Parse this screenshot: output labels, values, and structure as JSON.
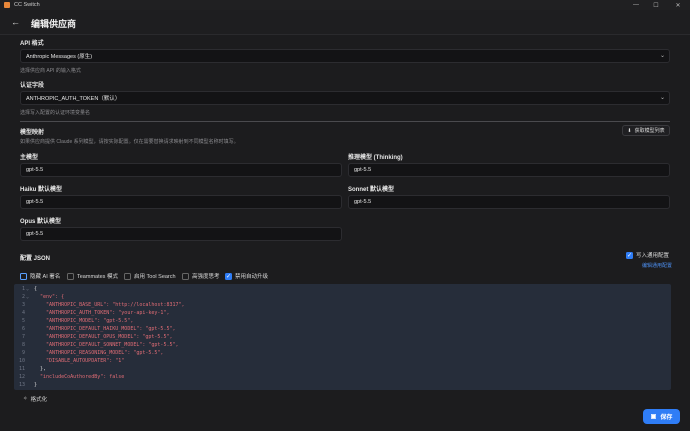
{
  "window": {
    "app_title": "CC Switch",
    "minimize": "—",
    "maximize": "☐",
    "close": "✕"
  },
  "header": {
    "back": "←",
    "title": "编辑供应商"
  },
  "api_format": {
    "label": "API 格式",
    "value": "Anthropic Messages (原生)",
    "hint": "选择供应商 API 的输入格式"
  },
  "auth_field": {
    "label": "认证字段",
    "value": "ANTHROPIC_AUTH_TOKEN（默认）",
    "hint": "选择写入配置的认证环境变量名"
  },
  "model_mapping": {
    "label": "模型映射",
    "hint": "如果供应商提供 Claude 系列模型，请按实际配置。仅在需要替换请求映射到不同模型名称时填写。",
    "fetch_button": "获取模型列表",
    "main_model": {
      "label": "主模型",
      "value": "gpt-5.5"
    },
    "thinking_model": {
      "label": "推理模型 (Thinking)",
      "value": "gpt-5.5"
    },
    "haiku_model": {
      "label": "Haiku 默认模型",
      "value": "gpt-5.5"
    },
    "sonnet_model": {
      "label": "Sonnet 默认模型",
      "value": "gpt-5.5"
    },
    "opus_model": {
      "label": "Opus 默认模型",
      "value": "gpt-5.5"
    }
  },
  "config_json": {
    "label": "配置 JSON",
    "write_common": "写入通用配置",
    "edit_common": "编辑通用配置",
    "options": [
      {
        "label": "隐藏 AI 署名",
        "checked": false
      },
      {
        "label": "Teammates 模式",
        "checked": false
      },
      {
        "label": "启用 Tool Search",
        "checked": false
      },
      {
        "label": "高强度思考",
        "checked": false
      },
      {
        "label": "禁用自动升级",
        "checked": true
      }
    ],
    "lines": [
      "{",
      "  \"env\": {",
      "    \"ANTHROPIC_BASE_URL\": \"http://localhost:8317\",",
      "    \"ANTHROPIC_AUTH_TOKEN\": \"your-api-key-1\",",
      "    \"ANTHROPIC_MODEL\": \"gpt-5.5\",",
      "    \"ANTHROPIC_DEFAULT_HAIKU_MODEL\": \"gpt-5.5\",",
      "    \"ANTHROPIC_DEFAULT_OPUS_MODEL\": \"gpt-5.5\",",
      "    \"ANTHROPIC_DEFAULT_SONNET_MODEL\": \"gpt-5.5\",",
      "    \"ANTHROPIC_REASONING_MODEL\": \"gpt-5.5\",",
      "    \"DISABLE_AUTOUPDATER\": \"1\"",
      "  },",
      "  \"includeCoAuthoredBy\": false",
      "}"
    ],
    "format_button": "格式化"
  },
  "footer": {
    "save": "保存"
  }
}
